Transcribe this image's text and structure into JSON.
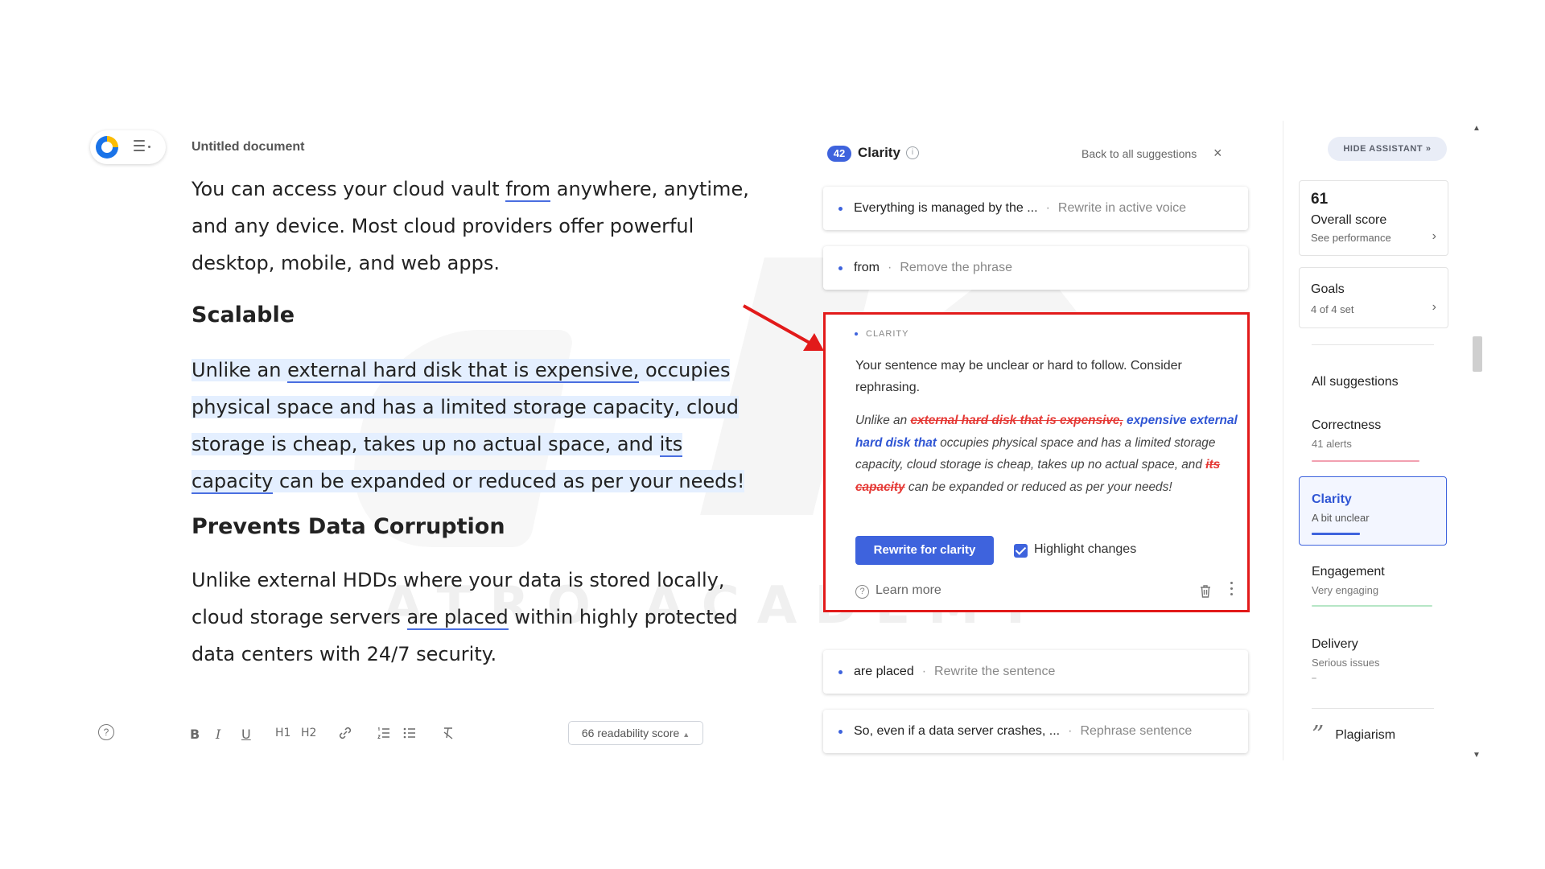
{
  "app": {
    "document_title": "Untitled document"
  },
  "document": {
    "para1": {
      "t1": "You can access your cloud vault ",
      "u1": "from",
      "t2": " anywhere, anytime, and any device. Most cloud providers offer powerful desktop, mobile, and web apps."
    },
    "heading1": "Scalable",
    "para2": {
      "t1": "Unlike an ",
      "u1": "external hard disk that is expensive,",
      "t2": " occupies physical space and has a limited storage capacity, cloud storage is cheap, takes up no actual space, and ",
      "u2": "its capacity",
      "t3": " can be expanded or reduced as per your needs!"
    },
    "heading2": "Prevents Data Corruption",
    "para3": {
      "t1": "Unlike external HDDs where your data is stored locally, cloud storage servers ",
      "u1": "are placed",
      "t2": " within highly protected data centers with 24/7 security."
    }
  },
  "toolbar": {
    "help": "?",
    "bold": "B",
    "italic": "I",
    "underline": "U",
    "h1": "H1",
    "h2": "H2",
    "readability": "66 readability score"
  },
  "watermark": "ATRO ACADEMY",
  "suggestions_panel": {
    "count": "42",
    "title": "Clarity",
    "back_link": "Back to all suggestions",
    "cards": [
      {
        "main": "Everything is managed by the ...",
        "sub": "Rewrite in active voice"
      },
      {
        "main": "from",
        "sub": "Remove the phrase"
      },
      {
        "main": "are placed",
        "sub": "Rewrite the sentence"
      },
      {
        "main": "So, even if a data server crashes, ...",
        "sub": "Rephrase sentence"
      }
    ],
    "expanded": {
      "label": "CLARITY",
      "message": "Your sentence may be unclear or hard to follow. Consider rephrasing.",
      "rewrite": {
        "t1": "Unlike an ",
        "del1": "external hard disk that is expensive,",
        "ins1": " expensive external hard disk that",
        "t2": " occupies physical space and has a limited storage capacity, cloud storage is cheap, takes up no actual space, and ",
        "del2": "its capacity",
        "t3": " can be expanded or reduced as per your needs!"
      },
      "button": "Rewrite for clarity",
      "checkbox_label": "Highlight changes",
      "checkbox_checked": true,
      "learn_more": "Learn more"
    }
  },
  "sidebar": {
    "hide_assistant": "HIDE ASSISTANT",
    "score": {
      "value": "61",
      "label": "Overall score",
      "link": "See performance"
    },
    "goals": {
      "label": "Goals",
      "sub": "4 of 4 set"
    },
    "all_suggestions": "All suggestions",
    "categories": [
      {
        "label": "Correctness",
        "sub": "41 alerts",
        "color": "#f2a0b0"
      },
      {
        "label": "Clarity",
        "sub": "A bit unclear",
        "color": "#3e63dd"
      },
      {
        "label": "Engagement",
        "sub": "Very engaging",
        "color": "#b6e6c6"
      },
      {
        "label": "Delivery",
        "sub": "Serious issues",
        "color": "#d0d0d0"
      }
    ],
    "plagiarism": "Plagiarism"
  },
  "colors": {
    "accent": "#3e63dd",
    "highlight_box": "#e21a1a",
    "deletion": "#e53935"
  }
}
